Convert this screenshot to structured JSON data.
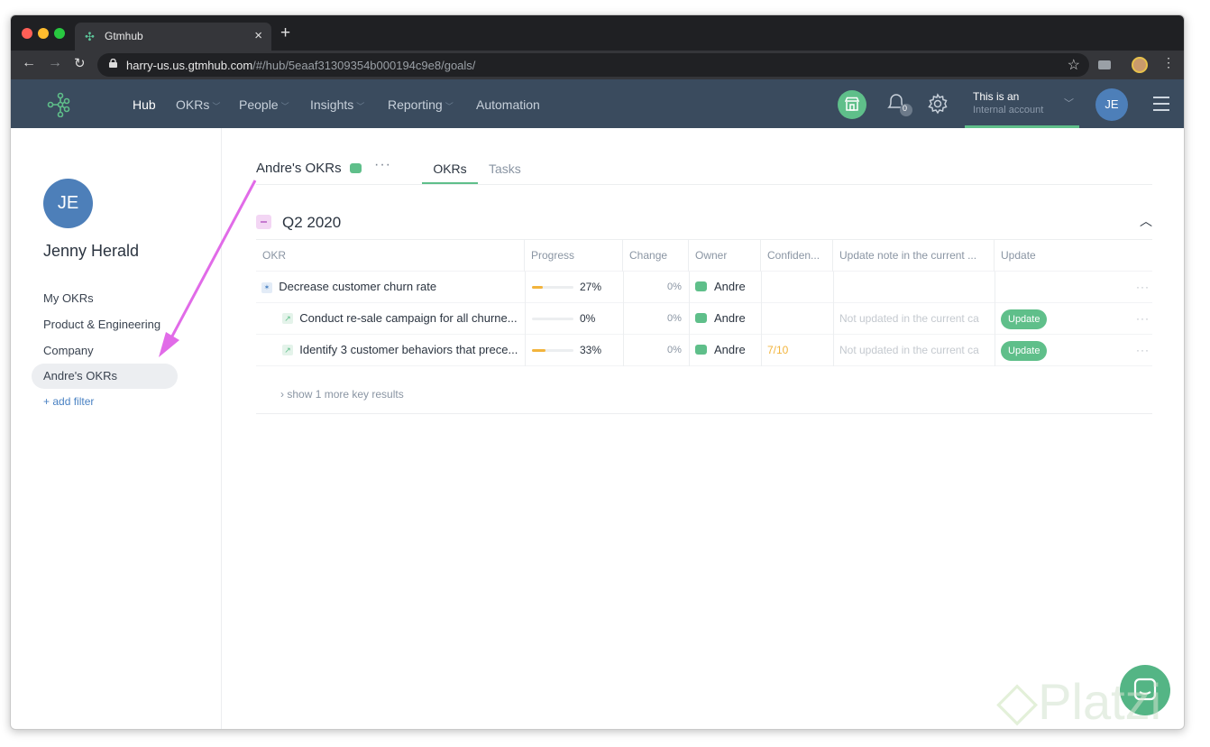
{
  "browser": {
    "tab_title": "Gtmhub",
    "url_host": "harry-us.us.gtmhub.com",
    "url_path": "/#/hub/5eaaf31309354b000194c9e8/goals/"
  },
  "nav": {
    "items": [
      "Hub",
      "OKRs",
      "People",
      "Insights",
      "Reporting",
      "Automation"
    ],
    "notifications_count": "0",
    "account_line1": "This is an",
    "account_line2": "Internal account",
    "user_initials": "JE"
  },
  "sidebar": {
    "initials": "JE",
    "user_name": "Jenny Herald",
    "items": [
      "My OKRs",
      "Product & Engineering",
      "Company",
      "Andre's OKRs"
    ],
    "add_filter": "+ add filter"
  },
  "main": {
    "title": "Andre's OKRs",
    "tabs": [
      "OKRs",
      "Tasks"
    ],
    "quarter": "Q2 2020",
    "columns": [
      "OKR",
      "Progress",
      "Change",
      "Owner",
      "Confiden...",
      "Update note in the current ...",
      "Update"
    ],
    "rows": [
      {
        "name": "Decrease customer churn rate",
        "progress": "27%",
        "progress_value": 0.27,
        "change": "0%",
        "owner": "Andre",
        "confidence": "",
        "note": "",
        "update": ""
      },
      {
        "name": "Conduct re-sale campaign for all churne...",
        "progress": "0%",
        "progress_value": 0.0,
        "change": "0%",
        "owner": "Andre",
        "confidence": "",
        "note": "Not updated in the current ca",
        "update": "Update"
      },
      {
        "name": "Identify 3 customer behaviors that prece...",
        "progress": "33%",
        "progress_value": 0.33,
        "change": "0%",
        "owner": "Andre",
        "confidence": "7/10",
        "note": "Not updated in the current ca",
        "update": "Update"
      }
    ],
    "show_more": "show 1 more key results"
  },
  "watermark": "Platzi",
  "colors": {
    "accent": "#5fbf8a",
    "header": "#3a4b5e",
    "avatar": "#4d7fb9",
    "arrow": "#e16be8",
    "progress": "#f2b43c"
  }
}
